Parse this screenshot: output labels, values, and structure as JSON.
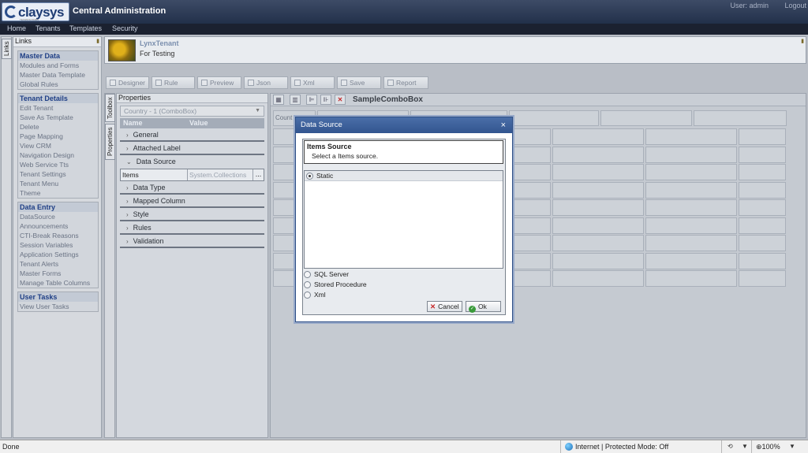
{
  "header": {
    "logo_text": "claysys",
    "logo_sub": "TECHNOLOGIES",
    "app_title": "Central Administration",
    "user": "User: admin",
    "logout": "Logout"
  },
  "nav": {
    "items": [
      "Home",
      "Tenants",
      "Templates",
      "Security"
    ]
  },
  "links": {
    "tab_label": "Links",
    "title": "Links",
    "groups": [
      {
        "title": "Master Data",
        "items": [
          "Modules and Forms",
          "Master Data Template",
          "Global Rules"
        ]
      },
      {
        "title": "Tenant Details",
        "items": [
          "Edit Tenant",
          "Save As Template",
          "Delete",
          "Page Mapping",
          "View CRM",
          "Navigation Design",
          "Web Service Tts",
          "Tenant Settings",
          "Tenant Menu",
          "Theme"
        ]
      },
      {
        "title": "Data Entry",
        "items": [
          "DataSource",
          "Announcements",
          "CTI-Break Reasons",
          "Session Variables",
          "Application Settings",
          "Tenant Alerts",
          "Master Forms",
          "Manage Table Columns"
        ]
      },
      {
        "title": "User Tasks",
        "items": [
          "View User Tasks"
        ]
      }
    ]
  },
  "tenant": {
    "name": "LynxTenant",
    "description": "For Testing"
  },
  "toolbar": {
    "buttons": [
      "Designer",
      "Rule",
      "Preview",
      "Json",
      "Xml",
      "Save",
      "Report"
    ]
  },
  "side_tabs": {
    "toolbox": "Toolbox",
    "properties": "Properties"
  },
  "properties": {
    "title": "Properties",
    "selected": "Country - 1 (ComboBox)",
    "col_name": "Name",
    "col_value": "Value",
    "categories_before": [
      "General",
      "Attached Label"
    ],
    "expanded_category": "Data Source",
    "row_key": "Items",
    "row_value": "System.Collections",
    "row_button": "...",
    "categories_after": [
      "Data Type",
      "Mapped Column",
      "Style",
      "Rules",
      "Validation"
    ]
  },
  "designer": {
    "title": "SampleComboBox",
    "cell_label": "Count"
  },
  "dialog": {
    "title": "Data Source",
    "close": "×",
    "section_title": "Items Source",
    "section_sub": "Select a Items source.",
    "options": [
      "Static",
      "SQL Server",
      "Stored Procedure",
      "Xml"
    ],
    "selected": "Static",
    "cancel": "Cancel",
    "ok": "Ok"
  },
  "statusbar": {
    "status": "Done",
    "zone": "Internet | Protected Mode: Off",
    "zoom": "100%"
  }
}
